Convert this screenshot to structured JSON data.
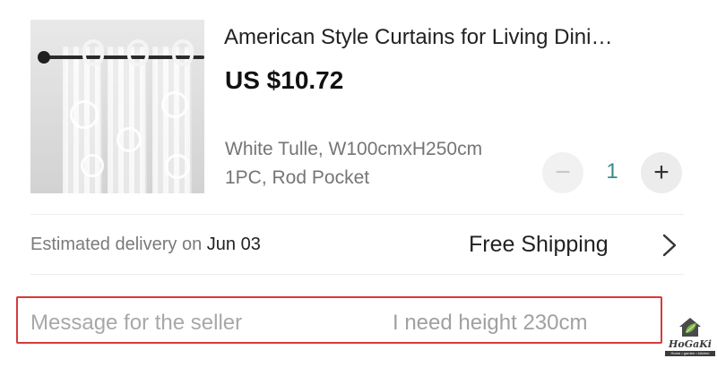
{
  "product": {
    "title": "American Style Curtains for Living Dini…",
    "price": "US $10.72",
    "variant_line1": "White Tulle, W100cmxH250cm",
    "variant_line2": "1PC, Rod Pocket",
    "image_icon": "curtain-product-image"
  },
  "quantity": {
    "minus_symbol": "−",
    "value": "1",
    "plus_symbol": "+"
  },
  "delivery": {
    "label": "Estimated delivery on ",
    "date": "Jun 03",
    "shipping": "Free Shipping",
    "chevron_icon": "chevron-right-icon"
  },
  "message": {
    "label": "Message for the seller",
    "value": "I need height 230cm",
    "highlight_color": "#d83a3a"
  },
  "watermark": {
    "brand": "HoGaKi",
    "tagline": "Home • garden • kitchen"
  },
  "colors": {
    "quantity_accent": "#3a8b8b"
  }
}
